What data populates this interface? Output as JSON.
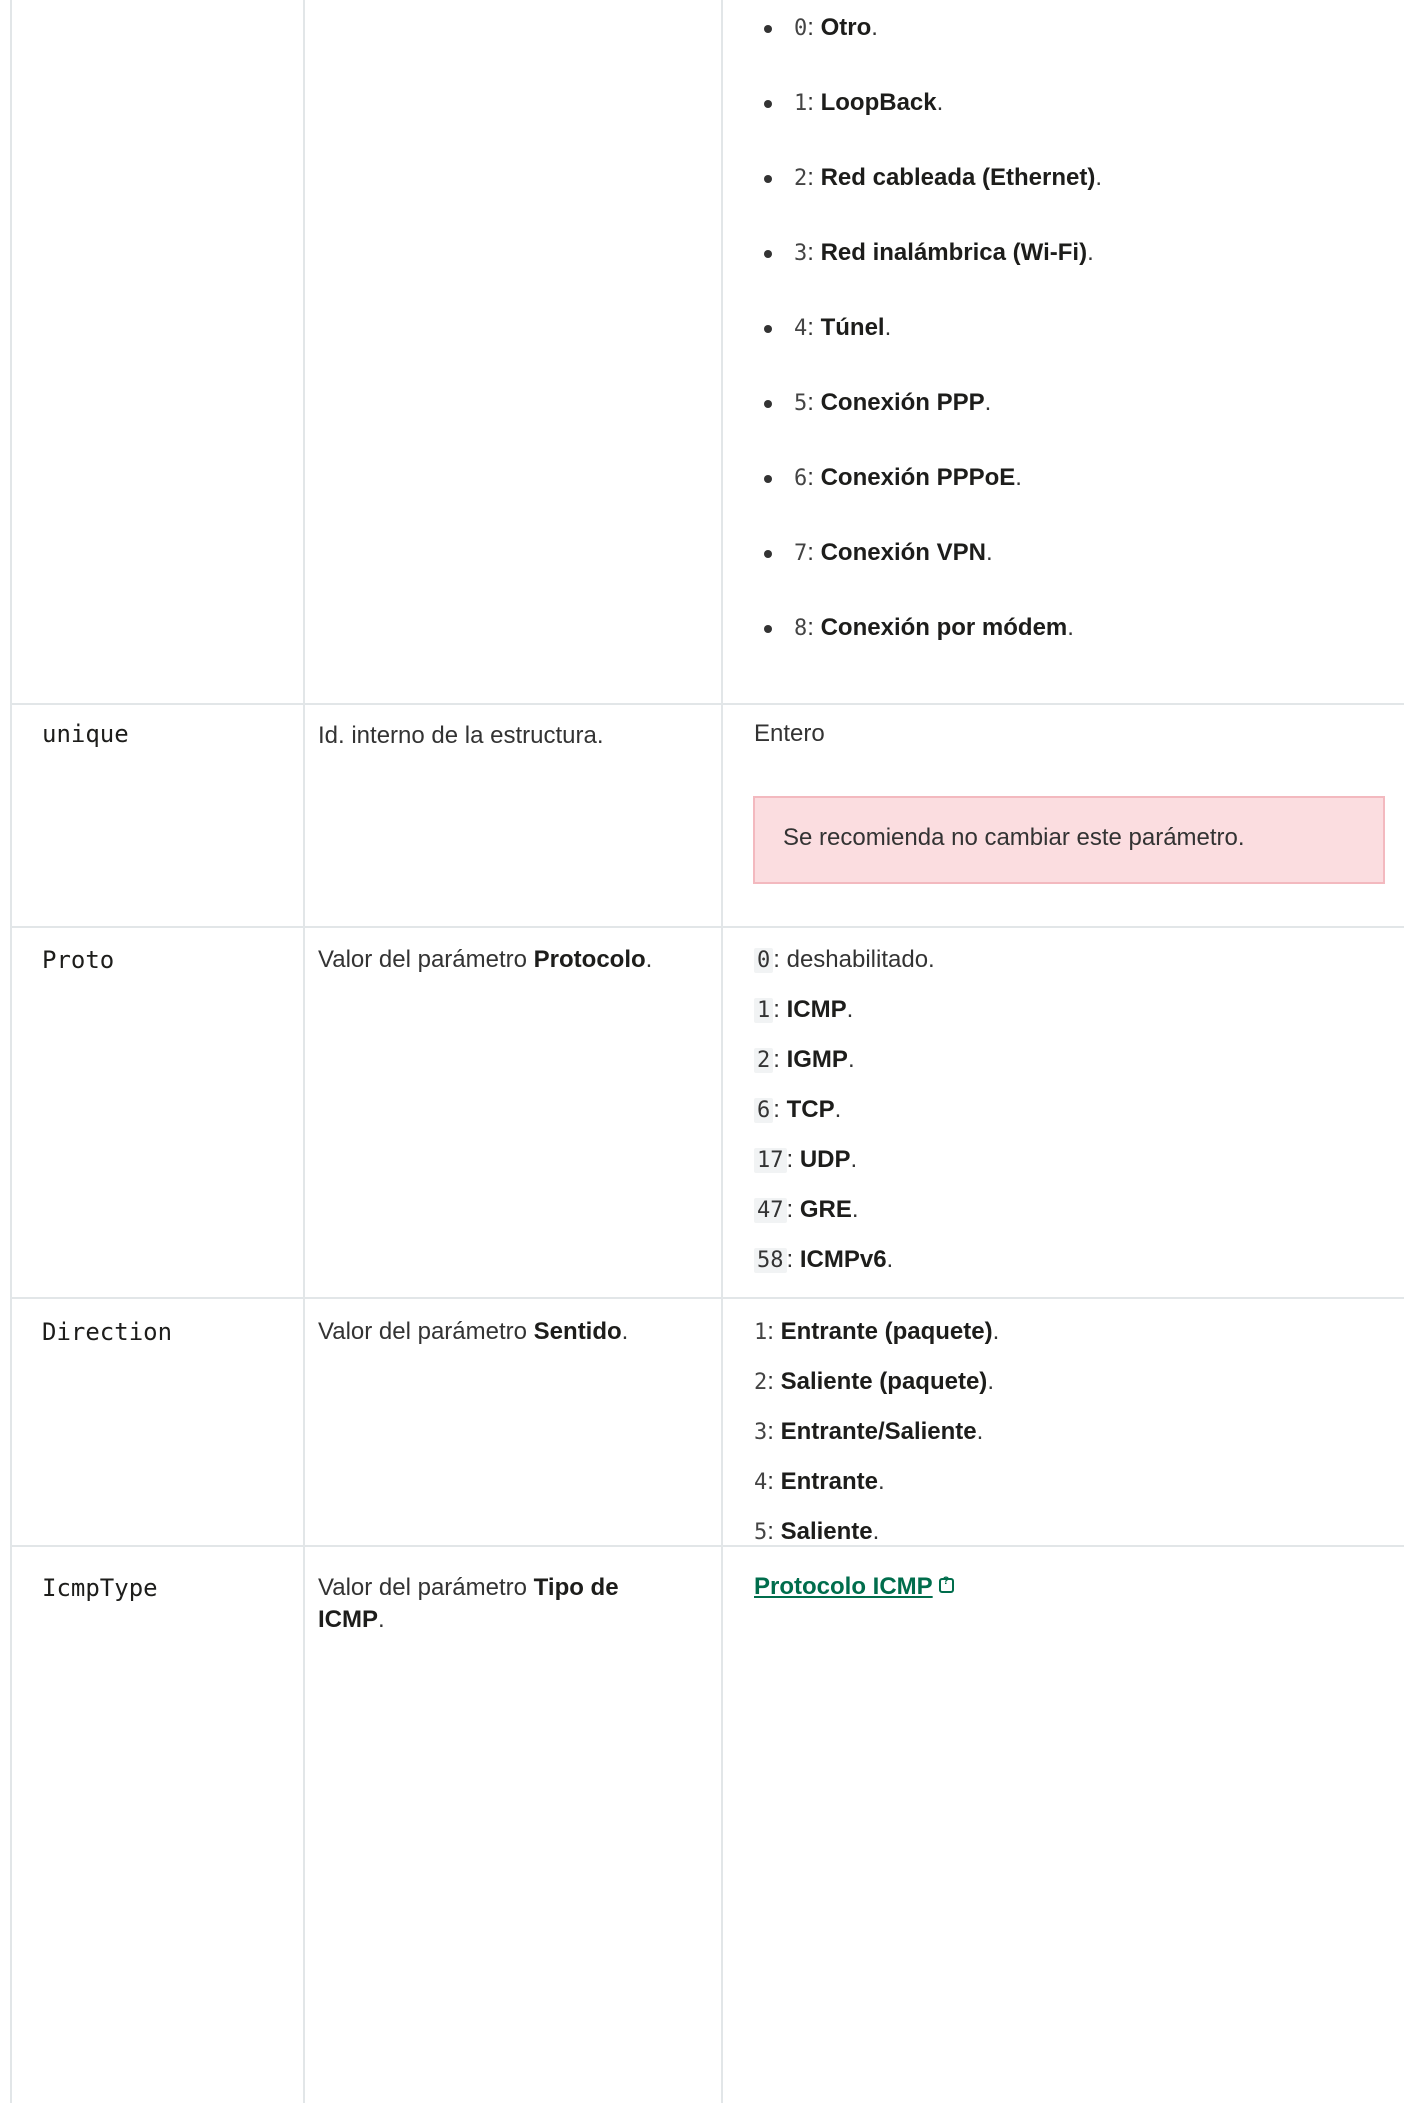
{
  "interface_types": [
    {
      "code": "0",
      "label": "Otro"
    },
    {
      "code": "1",
      "label": "LoopBack"
    },
    {
      "code": "2",
      "label": "Red cableada (Ethernet)"
    },
    {
      "code": "3",
      "label": "Red inalámbrica (Wi-Fi)"
    },
    {
      "code": "4",
      "label": "Túnel"
    },
    {
      "code": "5",
      "label": "Conexión PPP"
    },
    {
      "code": "6",
      "label": "Conexión PPPoE"
    },
    {
      "code": "7",
      "label": "Conexión VPN"
    },
    {
      "code": "8",
      "label": "Conexión por módem"
    }
  ],
  "rows": {
    "unique": {
      "name": "unique",
      "description": "Id. interno de la estructura.",
      "value": "Entero",
      "warning": "Se recomienda no cambiar este parámetro."
    },
    "proto": {
      "name": "Proto",
      "description_prefix": "Valor del parámetro ",
      "description_bold": "Protocolo",
      "values": [
        {
          "code": "0",
          "label": "deshabilitado",
          "bold": false
        },
        {
          "code": "1",
          "label": "ICMP",
          "bold": true
        },
        {
          "code": "2",
          "label": "IGMP",
          "bold": true
        },
        {
          "code": "6",
          "label": "TCP",
          "bold": true
        },
        {
          "code": "17",
          "label": "UDP",
          "bold": true
        },
        {
          "code": "47",
          "label": "GRE",
          "bold": true
        },
        {
          "code": "58",
          "label": "ICMPv6",
          "bold": true
        }
      ]
    },
    "direction": {
      "name": "Direction",
      "description_prefix": "Valor del parámetro ",
      "description_bold": "Sentido",
      "values": [
        {
          "code": "1",
          "label": "Entrante (paquete)"
        },
        {
          "code": "2",
          "label": "Saliente (paquete)"
        },
        {
          "code": "3",
          "label": "Entrante/Saliente"
        },
        {
          "code": "4",
          "label": "Entrante"
        },
        {
          "code": "5",
          "label": "Saliente"
        }
      ]
    },
    "icmptype": {
      "name": "IcmpType",
      "description_prefix": "Valor del parámetro ",
      "description_bold": "Tipo de ICMP",
      "link_text": "Protocolo ICMP",
      "link_icon": "external-help-icon"
    }
  }
}
